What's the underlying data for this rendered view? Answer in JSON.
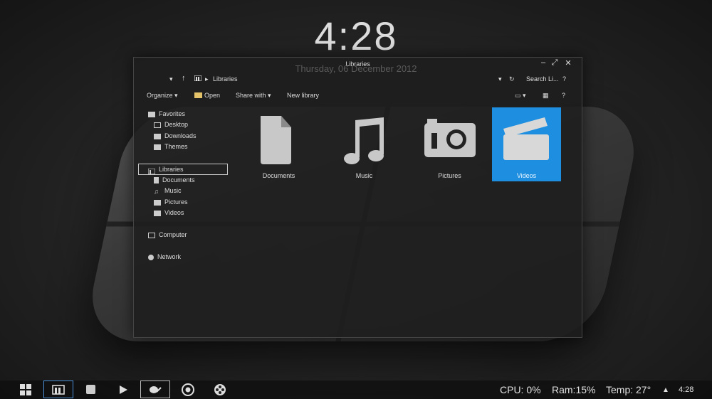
{
  "desktop": {
    "clock": "4:28",
    "date": "Thursday, 06 December 2012"
  },
  "window": {
    "title": "Libraries",
    "controls": {
      "minimize": "–",
      "maximize": "⤢",
      "close": "✕"
    },
    "address": {
      "path_root": "Libraries",
      "search_placeholder": "Search Li...",
      "help": "?"
    },
    "toolbar": {
      "organize": "Organize",
      "open": "Open",
      "share_with": "Share with",
      "new_library": "New library"
    },
    "nav": {
      "favorites": "Favorites",
      "desktop": "Desktop",
      "downloads": "Downloads",
      "themes": "Themes",
      "libraries": "Libraries",
      "documents": "Documents",
      "music": "Music",
      "pictures": "Pictures",
      "videos": "Videos",
      "computer": "Computer",
      "network": "Network"
    },
    "tiles": {
      "documents": "Documents",
      "music": "Music",
      "pictures": "Pictures",
      "videos": "Videos"
    },
    "selected_tile": "Videos"
  },
  "taskbar": {
    "cpu": "CPU: 0%",
    "ram": "Ram:15%",
    "temp": "Temp: 27°",
    "tray_clock": "4:28"
  },
  "colors": {
    "accent": "#1e8fe0",
    "text": "#e8e8e8"
  }
}
